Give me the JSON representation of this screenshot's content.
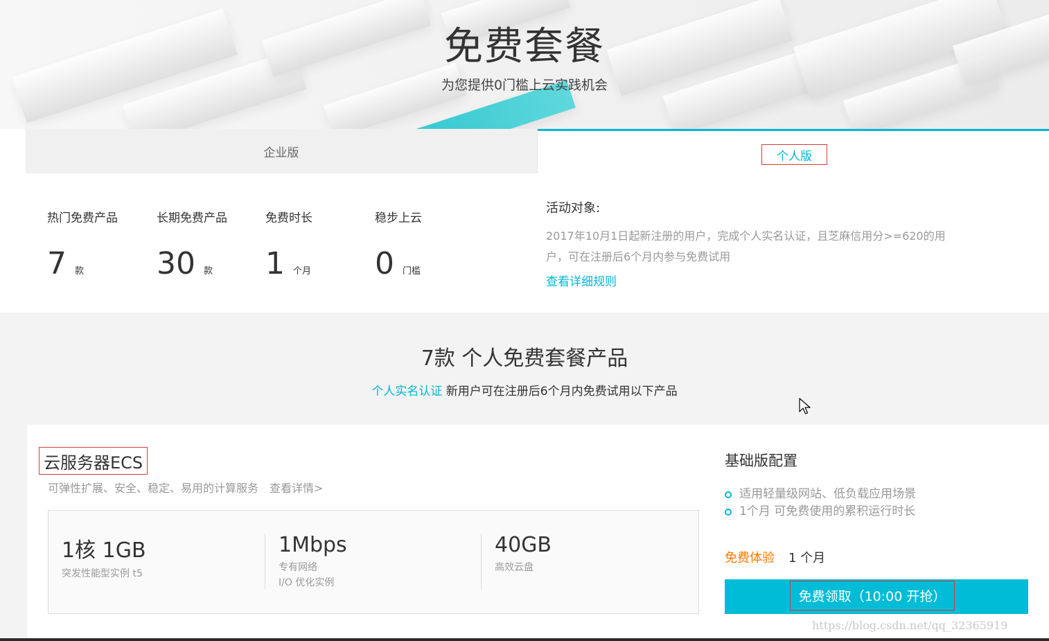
{
  "banner": {
    "title": "免费套餐",
    "subtitle": "为您提供0门槛上云实践机会"
  },
  "tabs": [
    {
      "label": "企业版",
      "active": false
    },
    {
      "label": "个人版",
      "active": true
    }
  ],
  "stats": [
    {
      "label": "热门免费产品",
      "value": "7",
      "unit": "款"
    },
    {
      "label": "长期免费产品",
      "value": "30",
      "unit": "款"
    },
    {
      "label": "免费时长",
      "value": "1",
      "unit": "个月"
    },
    {
      "label": "稳步上云",
      "value": "0",
      "unit": "门槛"
    }
  ],
  "activity": {
    "heading": "活动对象:",
    "description": "2017年10月1日起新注册的用户，完成个人实名认证，且芝麻信用分>=620的用户，可在注册后6个月内参与免费试用",
    "link": "查看详细规则"
  },
  "section": {
    "title": "7款 个人免费套餐产品",
    "highlight": "个人实名认证",
    "subtitle": "新用户可在注册后6个月内免费试用以下产品"
  },
  "product": {
    "name": "云服务器ECS",
    "description": "可弹性扩展、安全、稳定、易用的计算服务",
    "more": "查看详情>",
    "specs": [
      {
        "value": "1核 1GB",
        "details": [
          "突发性能型实例 t5"
        ]
      },
      {
        "value": "1Mbps",
        "details": [
          "专有网络",
          "I/O 优化实例"
        ]
      },
      {
        "value": "40GB",
        "details": [
          "高效云盘"
        ]
      }
    ],
    "config_title": "基础版配置",
    "features": [
      "适用轻量级网站、低负载应用场景",
      "1个月 可免费使用的累积运行时长"
    ],
    "trial_label": "免费体验",
    "trial_value": "1 个月",
    "button": "免费领取（10:00 开抢）"
  },
  "watermark": "https://blog.csdn.net/qq_32365919",
  "colors": {
    "accent": "#00b8d6",
    "orange": "#ff7800",
    "highlight_border": "#d63a3a"
  }
}
